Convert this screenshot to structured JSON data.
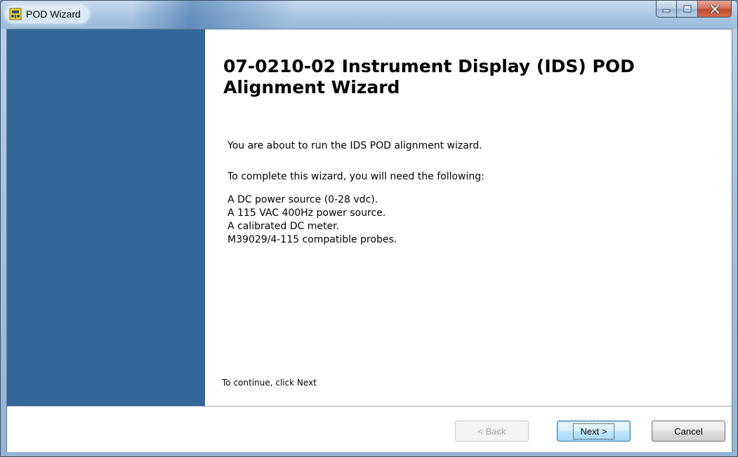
{
  "window": {
    "title": "POD Wizard"
  },
  "wizard": {
    "heading": "07-0210-02 Instrument Display (IDS) POD Alignment Wizard",
    "intro": "You are about to run the IDS POD alignment wizard.",
    "need_text": "To complete this wizard, you will need the following:",
    "requirements": [
      "A DC power source (0-28 vdc).",
      "A 115 VAC 400Hz power source.",
      "A calibrated DC meter.",
      "M39029/4-115 compatible probes."
    ],
    "continue_hint": "To continue, click Next"
  },
  "buttons": {
    "back_label": "< Back",
    "next_label": "Next >",
    "cancel_label": "Cancel"
  },
  "colors": {
    "side_panel": "#336699",
    "close_button": "#c8553a"
  },
  "icons": {
    "app": "pod-icon",
    "minimize": "minimize-icon",
    "maximize": "maximize-icon",
    "close": "close-icon"
  }
}
